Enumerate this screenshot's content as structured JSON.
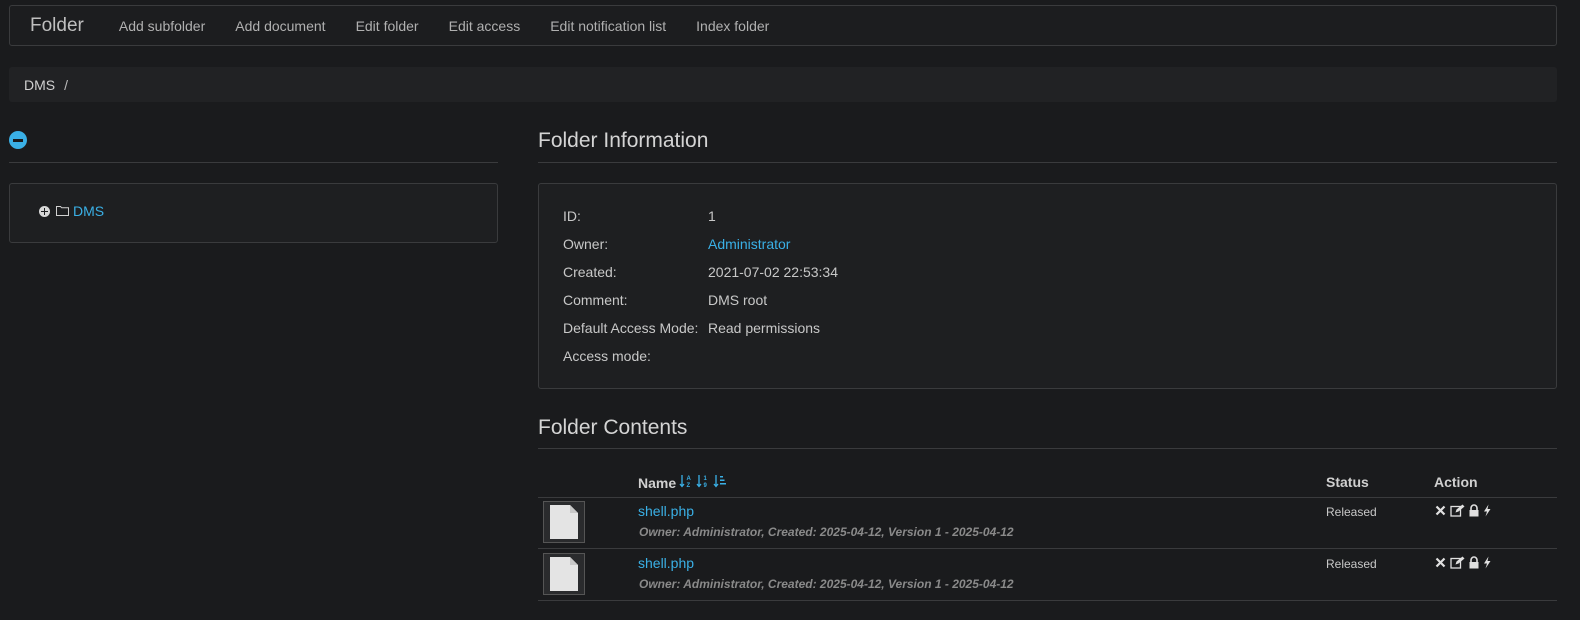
{
  "navbar": {
    "brand": "Folder",
    "items": [
      "Add subfolder",
      "Add document",
      "Edit folder",
      "Edit access",
      "Edit notification list",
      "Index folder"
    ]
  },
  "breadcrumb": {
    "root": "DMS",
    "separator": "/"
  },
  "tree": {
    "root_label": "DMS"
  },
  "folder_info": {
    "title": "Folder Information",
    "fields": [
      {
        "label": "ID:",
        "value": "1"
      },
      {
        "label": "Owner:",
        "value": "Administrator"
      },
      {
        "label": "Created:",
        "value": "2021-07-02 22:53:34"
      },
      {
        "label": "Comment:",
        "value": "DMS root"
      },
      {
        "label": "Default Access Mode:",
        "value": "Read permissions"
      },
      {
        "label": "Access mode:",
        "value": ""
      }
    ]
  },
  "folder_contents": {
    "title": "Folder Contents",
    "headers": {
      "name": "Name",
      "status": "Status",
      "action": "Action"
    },
    "rows": [
      {
        "name": "shell.php",
        "meta": "Owner: Administrator, Created: 2025-04-12, Version 1 - 2025-04-12",
        "status": "Released"
      },
      {
        "name": "shell.php",
        "meta": "Owner: Administrator, Created: 2025-04-12, Version 1 - 2025-04-12",
        "status": "Released"
      }
    ]
  },
  "icons": {
    "collapse": "minus-circle-icon",
    "expand": "plus-circle-icon",
    "folder": "folder-icon",
    "sort": [
      "sort-alpha-icon",
      "sort-numeric-icon",
      "sort-amount-icon"
    ],
    "actions": [
      "delete-icon",
      "edit-icon",
      "lock-icon",
      "bolt-icon"
    ]
  },
  "colors": {
    "accent": "#3ab0e6",
    "background": "#1a1b1d"
  }
}
